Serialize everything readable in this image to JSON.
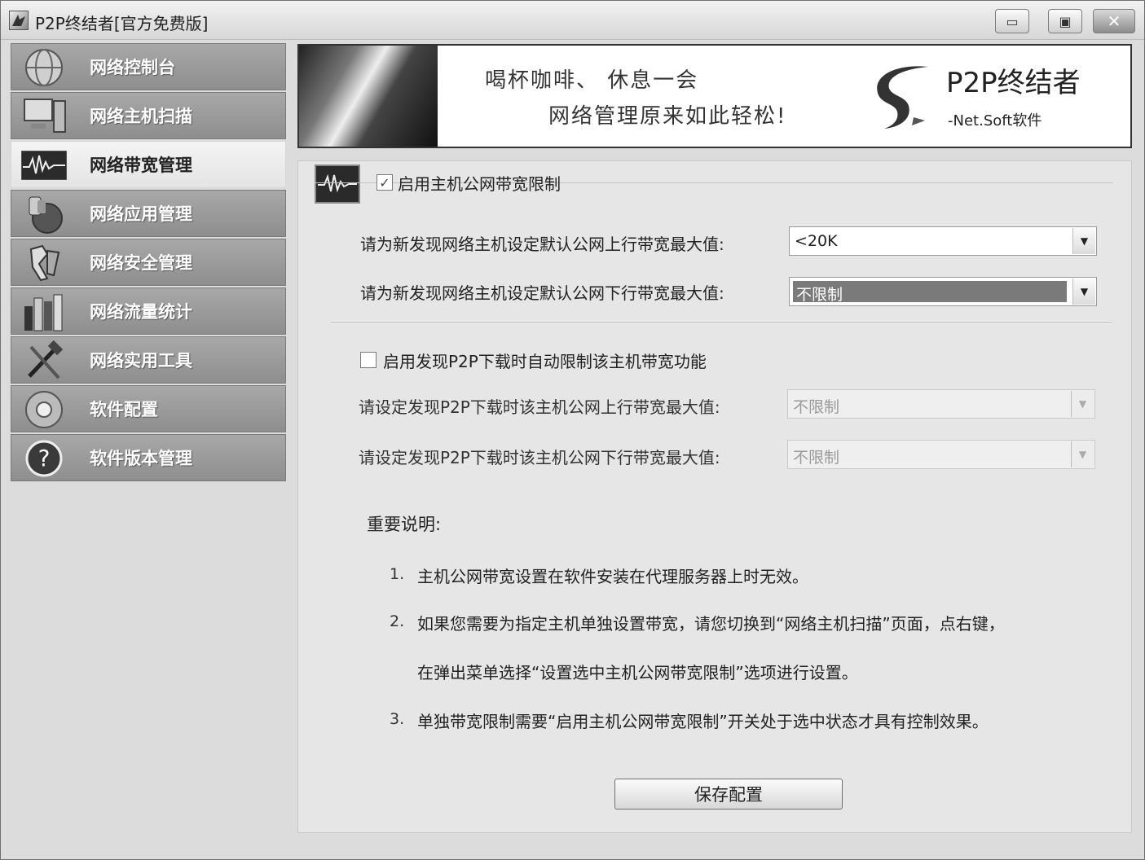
{
  "window": {
    "title": "P2P终结者[官方免费版]",
    "min_label": "▭",
    "max_label": "▣",
    "close_label": "✕"
  },
  "sidebar": {
    "items": [
      {
        "label": "网络控制台",
        "icon": "globe-icon",
        "active": false
      },
      {
        "label": "网络主机扫描",
        "icon": "computer-icon",
        "active": false
      },
      {
        "label": "网络带宽管理",
        "icon": "waveform-icon",
        "active": true
      },
      {
        "label": "网络应用管理",
        "icon": "apps-icon",
        "active": false
      },
      {
        "label": "网络安全管理",
        "icon": "security-icon",
        "active": false
      },
      {
        "label": "网络流量统计",
        "icon": "statistics-icon",
        "active": false
      },
      {
        "label": "网络实用工具",
        "icon": "tools-icon",
        "active": false
      },
      {
        "label": "软件配置",
        "icon": "config-icon",
        "active": false
      },
      {
        "label": "软件版本管理",
        "icon": "help-icon",
        "active": false
      }
    ]
  },
  "banner": {
    "slogan_line1": "喝杯咖啡、  休息一会",
    "slogan_line2": "网络管理原来如此轻松!",
    "brand": "P2P终结者",
    "sub": "-Net.Soft软件"
  },
  "bandwidth": {
    "enable_label": "启用主机公网带宽限制",
    "enable_checked": true,
    "upload_label": "请为新发现网络主机设定默认公网上行带宽最大值:",
    "upload_value": "<20K",
    "download_label": "请为新发现网络主机设定默认公网下行带宽最大值:",
    "download_value": "不限制"
  },
  "p2p": {
    "enable_label": "启用发现P2P下载时自动限制该主机带宽功能",
    "enable_checked": false,
    "upload_label": "请设定发现P2P下载时该主机公网上行带宽最大值:",
    "upload_value": "不限制",
    "download_label": "请设定发现P2P下载时该主机公网下行带宽最大值:",
    "download_value": "不限制"
  },
  "notes": {
    "title": "重要说明:",
    "items": [
      {
        "num": "1.",
        "text": "主机公网带宽设置在软件安装在代理服务器上时无效。"
      },
      {
        "num": "2.",
        "text": "如果您需要为指定主机单独设置带宽，请您切换到“网络主机扫描”页面，点右键，"
      },
      {
        "num": "",
        "text": "在弹出菜单选择“设置选中主机公网带宽限制”选项进行设置。"
      },
      {
        "num": "3.",
        "text": "单独带宽限制需要“启用主机公网带宽限制”开关处于选中状态才具有控制效果。"
      }
    ]
  },
  "save_label": "保存配置"
}
